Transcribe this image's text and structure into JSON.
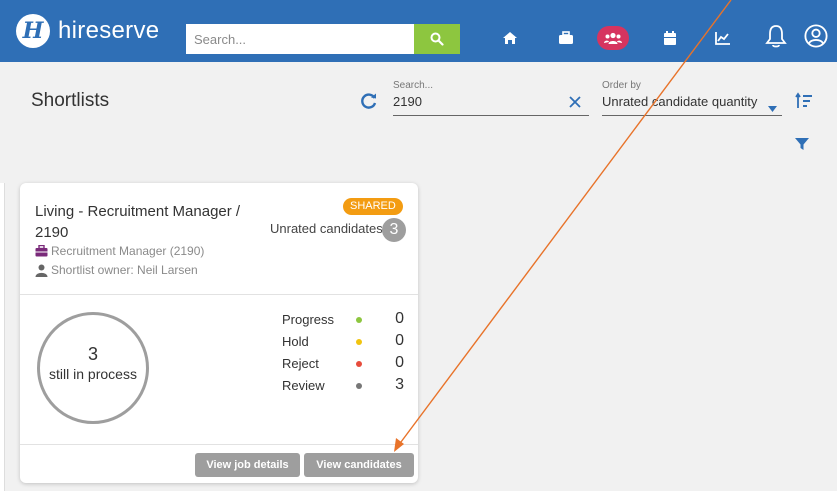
{
  "brand": {
    "logo_letter": "H",
    "name": "hireserve"
  },
  "topbar": {
    "search_placeholder": "Search...",
    "icons": [
      "search-icon",
      "home-icon",
      "briefcase-icon",
      "users-icon",
      "calendar-icon",
      "chart-icon",
      "bell-icon",
      "user-profile-icon"
    ]
  },
  "page": {
    "title": "Shortlists"
  },
  "filters": {
    "search_label": "Search...",
    "search_value": "2190",
    "order_label": "Order by",
    "order_value": "Unrated candidate quantity"
  },
  "card": {
    "title": "Living - Recruitment Manager / 2190",
    "shared_badge": "SHARED",
    "unrated_label": "Unrated candidates",
    "unrated_count": "3",
    "job_line": "Recruitment Manager (2190)",
    "owner_line": "Shortlist owner: Neil Larsen",
    "in_process_count": "3",
    "in_process_label": "still in process",
    "stats": [
      {
        "name": "Progress",
        "value": "0",
        "color": "#8dc63f"
      },
      {
        "name": "Hold",
        "value": "0",
        "color": "#f1c40f"
      },
      {
        "name": "Reject",
        "value": "0",
        "color": "#e74c3c"
      },
      {
        "name": "Review",
        "value": "3",
        "color": "#777777"
      }
    ],
    "view_job_label": "View job details",
    "view_candidates_label": "View candidates"
  },
  "colors": {
    "nav": "#2f6fb6",
    "accent_green": "#8dc63f",
    "active_nav": "#d6345f",
    "badge": "#f39c12",
    "annotation_arrow": "#e8732a"
  }
}
